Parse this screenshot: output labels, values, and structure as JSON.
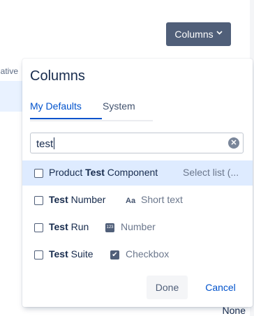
{
  "background": {
    "left_header_fragment": "ative",
    "bottom_right_value": "None"
  },
  "columns_button": {
    "label": "Columns",
    "chevron": "chevron-down-icon"
  },
  "popup": {
    "title": "Columns",
    "tabs": [
      {
        "label": "My Defaults",
        "active": true
      },
      {
        "label": "System",
        "active": false
      }
    ],
    "search": {
      "value": "test",
      "clear_icon": "clear-icon"
    },
    "items": [
      {
        "prefix": "Product ",
        "match": "Test",
        "suffix": " Component",
        "type_label": "Select list (...",
        "type_icon": "",
        "checked": false,
        "highlighted": true
      },
      {
        "prefix": "",
        "match": "Test",
        "suffix": " Number",
        "type_label": "Short text",
        "type_icon": "Aa",
        "checked": false,
        "highlighted": false
      },
      {
        "prefix": "",
        "match": "Test",
        "suffix": " Run",
        "type_label": "Number",
        "type_icon": "123",
        "checked": false,
        "highlighted": false
      },
      {
        "prefix": "",
        "match": "Test",
        "suffix": " Suite",
        "type_label": "Checkbox",
        "type_icon": "✔",
        "checked": false,
        "highlighted": false
      }
    ],
    "done_label": "Done",
    "cancel_label": "Cancel"
  },
  "colors": {
    "accent": "#0052cc",
    "button_dark": "#505f79",
    "highlight_row": "#deebff"
  }
}
